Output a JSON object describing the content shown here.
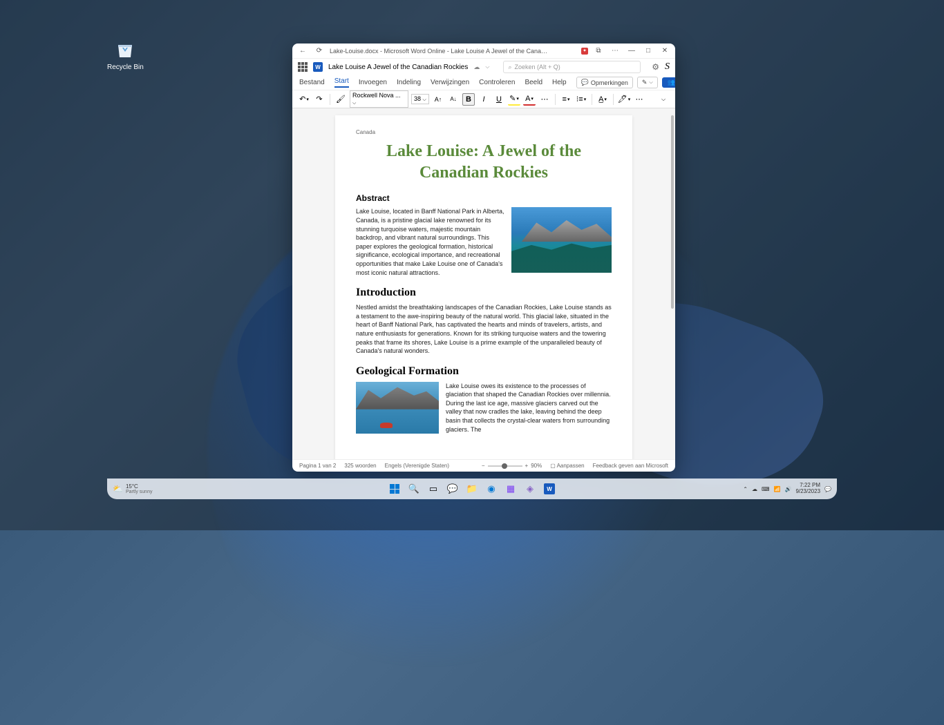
{
  "desktop": {
    "recycle_bin": "Recycle Bin"
  },
  "titlebar": {
    "tab1": "Lake-Louise.docx - Microsoft Word Online - Lake Louise A Jewel of the Canadian Rockies.docx - Micros..."
  },
  "appbar": {
    "doc_title": "Lake Louise A Jewel of the Canadian Rockies",
    "search_placeholder": "Zoeken (Alt + Q)",
    "avatar_letter": "S"
  },
  "menu": {
    "file": "Bestand",
    "home": "Start",
    "insert": "Invoegen",
    "layout": "Indeling",
    "references": "Verwijzingen",
    "review": "Controleren",
    "view": "Beeld",
    "help": "Help",
    "comments": "Opmerkingen",
    "share": "Delen"
  },
  "toolbar": {
    "font": "Rockwell Nova ...",
    "size": "38"
  },
  "document": {
    "header_right": "Canada",
    "title": "Lake Louise: A Jewel of the Canadian Rockies",
    "abstract_h": "Abstract",
    "abstract": "Lake Louise, located in Banff National Park in Alberta, Canada, is a pristine glacial lake renowned for its stunning turquoise waters, majestic mountain backdrop, and vibrant natural surroundings. This paper explores the geological formation, historical significance, ecological importance, and recreational opportunities that make Lake Louise one of Canada's most iconic natural attractions.",
    "intro_h": "Introduction",
    "intro": "Nestled amidst the breathtaking landscapes of the Canadian Rockies, Lake Louise stands as a testament to the awe-inspiring beauty of the natural world. This glacial lake, situated in the heart of Banff National Park, has captivated the hearts and minds of travelers, artists, and nature enthusiasts for generations. Known for its striking turquoise waters and the towering peaks that frame its shores, Lake Louise is a prime example of the unparalleled beauty of Canada's natural wonders.",
    "geo_h": "Geological Formation",
    "geo": "Lake Louise owes its existence to the processes of glaciation that shaped the Canadian Rockies over millennia. During the last ice age, massive glaciers carved out the valley that now cradles the lake, leaving behind the deep basin that collects the crystal-clear waters from surrounding glaciers. The"
  },
  "status": {
    "page": "Pagina 1 van 2",
    "words": "325 woorden",
    "lang": "Engels (Verenigde Staten)",
    "zoom": "90%",
    "fit": "Aanpassen",
    "feedback": "Feedback geven aan Microsoft"
  },
  "taskbar": {
    "temp": "15°C",
    "weather": "Partly sunny",
    "time": "7:22 PM",
    "date": "9/23/2023"
  }
}
